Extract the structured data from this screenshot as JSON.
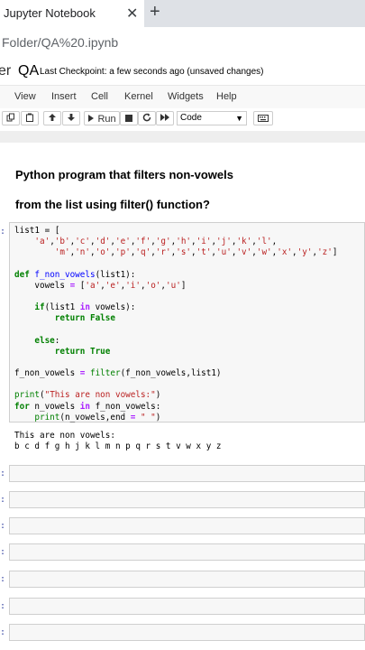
{
  "browser": {
    "tab_title": "Jupyter Notebook",
    "tab_close": "✕",
    "new_tab": "+",
    "url": "Folder/QA%20.ipynb"
  },
  "header": {
    "logo_fragment": "er",
    "notebook_title": "QA",
    "checkpoint": "Last Checkpoint: a few seconds ago  (unsaved changes)"
  },
  "menu": [
    "View",
    "Insert",
    "Cell",
    "Kernel",
    "Widgets",
    "Help"
  ],
  "toolbar": {
    "run_label": "Run",
    "cell_type": "Code"
  },
  "markdown": {
    "line1": "Python program that filters non-vowels",
    "line2": "from the list using filter() function?"
  },
  "prompt_glyph": ":",
  "output": {
    "line1": "This are non vowels:",
    "line2": "b c d f g h j k l m n p q r s t v w x y z"
  }
}
